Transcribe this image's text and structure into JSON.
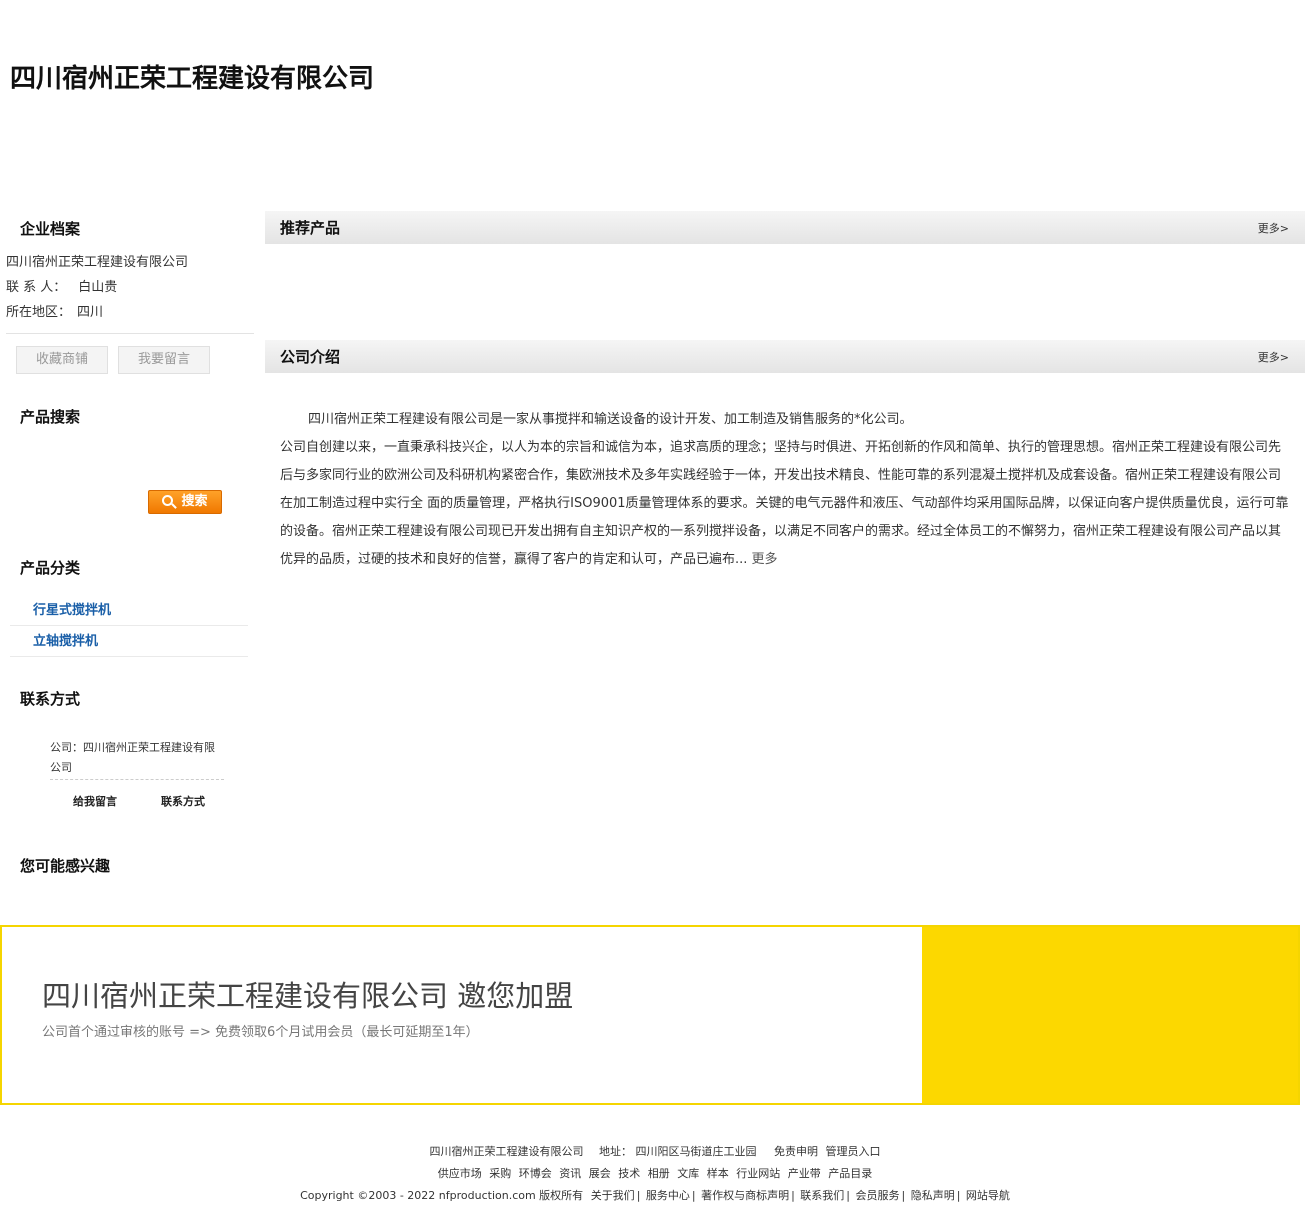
{
  "header": {
    "company_title": "四川宿州正荣工程建设有限公司"
  },
  "profile": {
    "title": "企业档案",
    "company": "四川宿州正荣工程建设有限公司",
    "contact_label": "联 系 人：",
    "contact_value": "白山贵",
    "region_label": "所在地区：",
    "region_value": "四川",
    "bookmark_button": "收藏商铺",
    "message_button": "我要留言"
  },
  "search": {
    "title": "产品搜索",
    "button_label": "搜索"
  },
  "categories": {
    "title": "产品分类",
    "items": [
      "行星式搅拌机",
      "立轴搅拌机"
    ]
  },
  "contact": {
    "title": "联系方式",
    "company": "公司：四川宿州正荣工程建设有限公司",
    "leave_message": "给我留言",
    "contact_info": "联系方式"
  },
  "interest": {
    "title": "您可能感兴趣"
  },
  "recommend": {
    "title": "推荐产品",
    "more": "更多>"
  },
  "intro": {
    "title": "公司介绍",
    "more": "更多>",
    "para1": "四川宿州正荣工程建设有限公司是一家从事搅拌和输送设备的设计开发、加工制造及销售服务的*化公司。",
    "para2": "公司自创建以来，一直秉承科技兴企，以人为本的宗旨和诚信为本，追求高质的理念；坚持与时俱进、开拓创新的作风和简单、执行的管理思想。宿州正荣工程建设有限公司先后与多家同行业的欧洲公司及科研机构紧密合作，集欧洲技术及多年实践经验于一体，开发出技术精良、性能可靠的系列混凝土搅拌机及成套设备。宿州正荣工程建设有限公司在加工制造过程中实行全 面的质量管理，严格执行ISO9001质量管理体系的要求。关键的电气元器件和液压、气动部件均采用国际品牌，以保证向客户提供质量优良，运行可靠的设备。宿州正荣工程建设有限公司现已开发出拥有自主知识产权的一系列搅拌设备，以满足不同客户的需求。经过全体员工的不懈努力，宿州正荣工程建设有限公司产品以其优异的品质，过硬的技术和良好的信誉，赢得了客户的肯定和认可，产品已遍布...",
    "more_link": "更多"
  },
  "join": {
    "title": "四川宿州正荣工程建设有限公司 邀您加盟",
    "subtitle": "公司首个通过审核的账号 => 免费领取6个月试用会员（最长可延期至1年）"
  },
  "footer": {
    "line1_company": "四川宿州正荣工程建设有限公司",
    "line1_address": "地址： 四川阳区马街道庄工业园",
    "line1_disclaimer": "免责申明",
    "line1_admin": "管理员入口",
    "line2_links": [
      "供应市场",
      "采购",
      "环博会",
      "资讯",
      "展会",
      "技术",
      "相册",
      "文库",
      "样本",
      "行业网站",
      "产业带",
      "产品目录"
    ],
    "copyright": "Copyright ©2003 - 2022 nfproduction.com 版权所有",
    "line3_links": [
      "关于我们",
      "服务中心",
      "著作权与商标声明",
      "联系我们",
      "会员服务",
      "隐私声明",
      "网站导航"
    ]
  },
  "colors": {
    "accent_blue": "#1a5fa8",
    "join_yellow": "#fcd800",
    "search_orange": "#f07800"
  }
}
